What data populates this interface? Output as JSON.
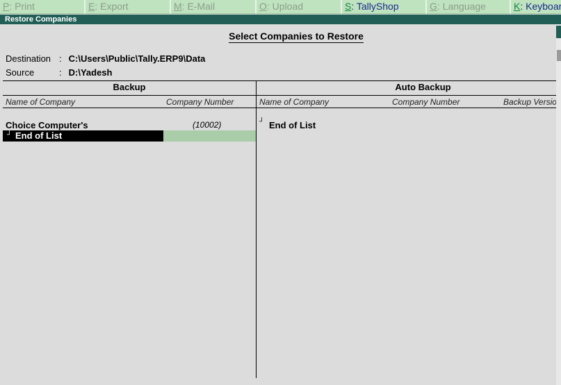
{
  "menubar": {
    "items": [
      {
        "key": "P",
        "rest": ": Print",
        "enabled": false
      },
      {
        "key": "E",
        "rest": ": Export",
        "enabled": false
      },
      {
        "key": "M",
        "rest": ": E-Mail",
        "enabled": false
      },
      {
        "key": "O",
        "rest": ": Upload",
        "enabled": false
      },
      {
        "key": "S",
        "rest": ": TallyShop",
        "enabled": true
      },
      {
        "key": "G",
        "rest": ": Language",
        "enabled": false
      },
      {
        "key": "K",
        "rest": ": Keyboard",
        "enabled": true
      }
    ]
  },
  "window": {
    "title": "Restore Companies"
  },
  "main": {
    "heading": "Select Companies to Restore",
    "destination_label": "Destination",
    "destination_value": "C:\\Users\\Public\\Tally.ERP9\\Data",
    "source_label": "Source",
    "source_value": "D:\\Yadesh",
    "separator": ":"
  },
  "backup": {
    "title": "Backup",
    "col_name": "Name of Company",
    "col_number": "Company Number",
    "rows": [
      {
        "name": "Choice Computer's",
        "number": "(10002)"
      }
    ],
    "end_of_list": "End of List"
  },
  "auto_backup": {
    "title": "Auto Backup",
    "col_name": "Name of Company",
    "col_number": "Company Number",
    "col_version": "Backup Version",
    "end_of_list": "End of List"
  },
  "colors": {
    "menubar_bg": "#bfe2bf",
    "titlebar_bg": "#215f56",
    "panel_bg": "#dcdcdc",
    "selection_bg": "#000000",
    "selection_accent": "#a8cda8"
  }
}
